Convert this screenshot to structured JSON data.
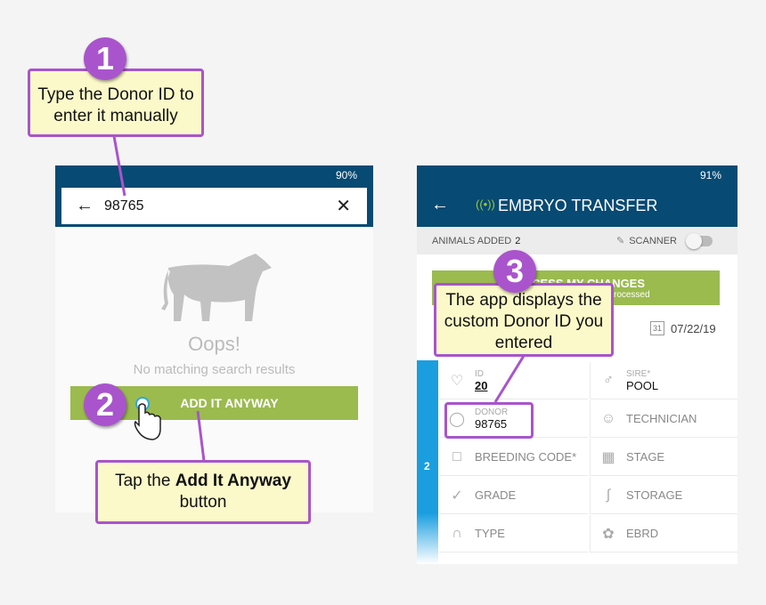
{
  "left_screen": {
    "status": "90%",
    "search_value": "98765",
    "empty_title": "Oops!",
    "empty_message": "No matching search results",
    "add_button": "ADD IT ANYWAY"
  },
  "right_screen": {
    "status": "91%",
    "title": "EMBRYO TRANSFER",
    "animals_added_label": "ANIMALS ADDED",
    "animals_added_count": "2",
    "scanner_label": "SCANNER",
    "process_button": "PROCESS MY CHANGES",
    "process_sub": "processed",
    "date": "07/22/19",
    "row_number": "2",
    "fields": [
      {
        "label": "ID",
        "value": "20",
        "icon": "tag-icon"
      },
      {
        "label": "SIRE*",
        "value": "POOL",
        "icon": "male-icon"
      },
      {
        "label": "DONOR",
        "value": "98765",
        "icon": "donor-icon"
      },
      {
        "label": "TECHNICIAN",
        "icon": "person-icon"
      },
      {
        "label": "BREEDING CODE*",
        "icon": "clipboard-icon"
      },
      {
        "label": "STAGE",
        "icon": "calendar-icon"
      },
      {
        "label": "GRADE",
        "icon": "check-badge-icon"
      },
      {
        "label": "STORAGE",
        "icon": "thermometer-icon"
      },
      {
        "label": "TYPE",
        "icon": "test-tube-icon"
      },
      {
        "label": "EBRD",
        "icon": "embryo-icon"
      }
    ]
  },
  "callouts": {
    "step1_num": "1",
    "step1_text": "Type the Donor ID to enter it manually",
    "step2_num": "2",
    "step2_pre": "Tap the",
    "step2_bold": "Add It Anyway",
    "step2_post": "button",
    "step3_num": "3",
    "step3_text": "The app displays the custom Donor ID you entered"
  },
  "colors": {
    "header": "#074a73",
    "green": "#9bbb4f",
    "accent_purple": "#a954cc",
    "callout_bg": "#fbf9c9",
    "row_blue": "#1a9ee0"
  }
}
